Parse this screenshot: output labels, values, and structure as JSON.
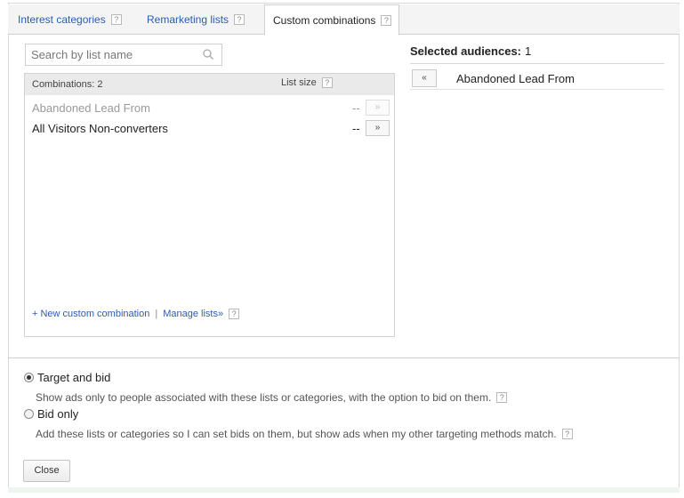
{
  "tabs": [
    {
      "label": "Interest categories",
      "help": "?",
      "active": false
    },
    {
      "label": "Remarketing lists",
      "help": "?",
      "active": false
    },
    {
      "label": "Custom combinations",
      "help": "?",
      "active": true
    }
  ],
  "search": {
    "placeholder": "Search by list name",
    "icon": "search-icon"
  },
  "list": {
    "combinations_label": "Combinations: 2",
    "list_size_label": "List size",
    "help": "?",
    "rows": [
      {
        "name": "Abandoned Lead From",
        "size": "--",
        "button": "»",
        "disabled": true
      },
      {
        "name": "All Visitors Non-converters",
        "size": "--",
        "button": "»",
        "disabled": false
      }
    ],
    "footer": {
      "new_combination": "+ New custom combination",
      "separator": "|",
      "manage_lists": "Manage lists»",
      "help": "?"
    }
  },
  "selected": {
    "title": "Selected audiences:",
    "count": "1",
    "items": [
      {
        "button": "«",
        "name": "Abandoned Lead From"
      }
    ]
  },
  "targeting": {
    "option1": {
      "label": "Target and bid",
      "checked": true,
      "description": "Show ads only to people associated with these lists or categories, with the option to bid on them.",
      "help": "?"
    },
    "option2": {
      "label": "Bid only",
      "checked": false,
      "description": "Add these lists or categories so I can set bids on them, but show ads when my other targeting methods match.",
      "help": "?"
    }
  },
  "close_label": "Close",
  "colors": {
    "link": "#2a5db0",
    "muted": "#999999",
    "border": "#cfcfcf"
  }
}
